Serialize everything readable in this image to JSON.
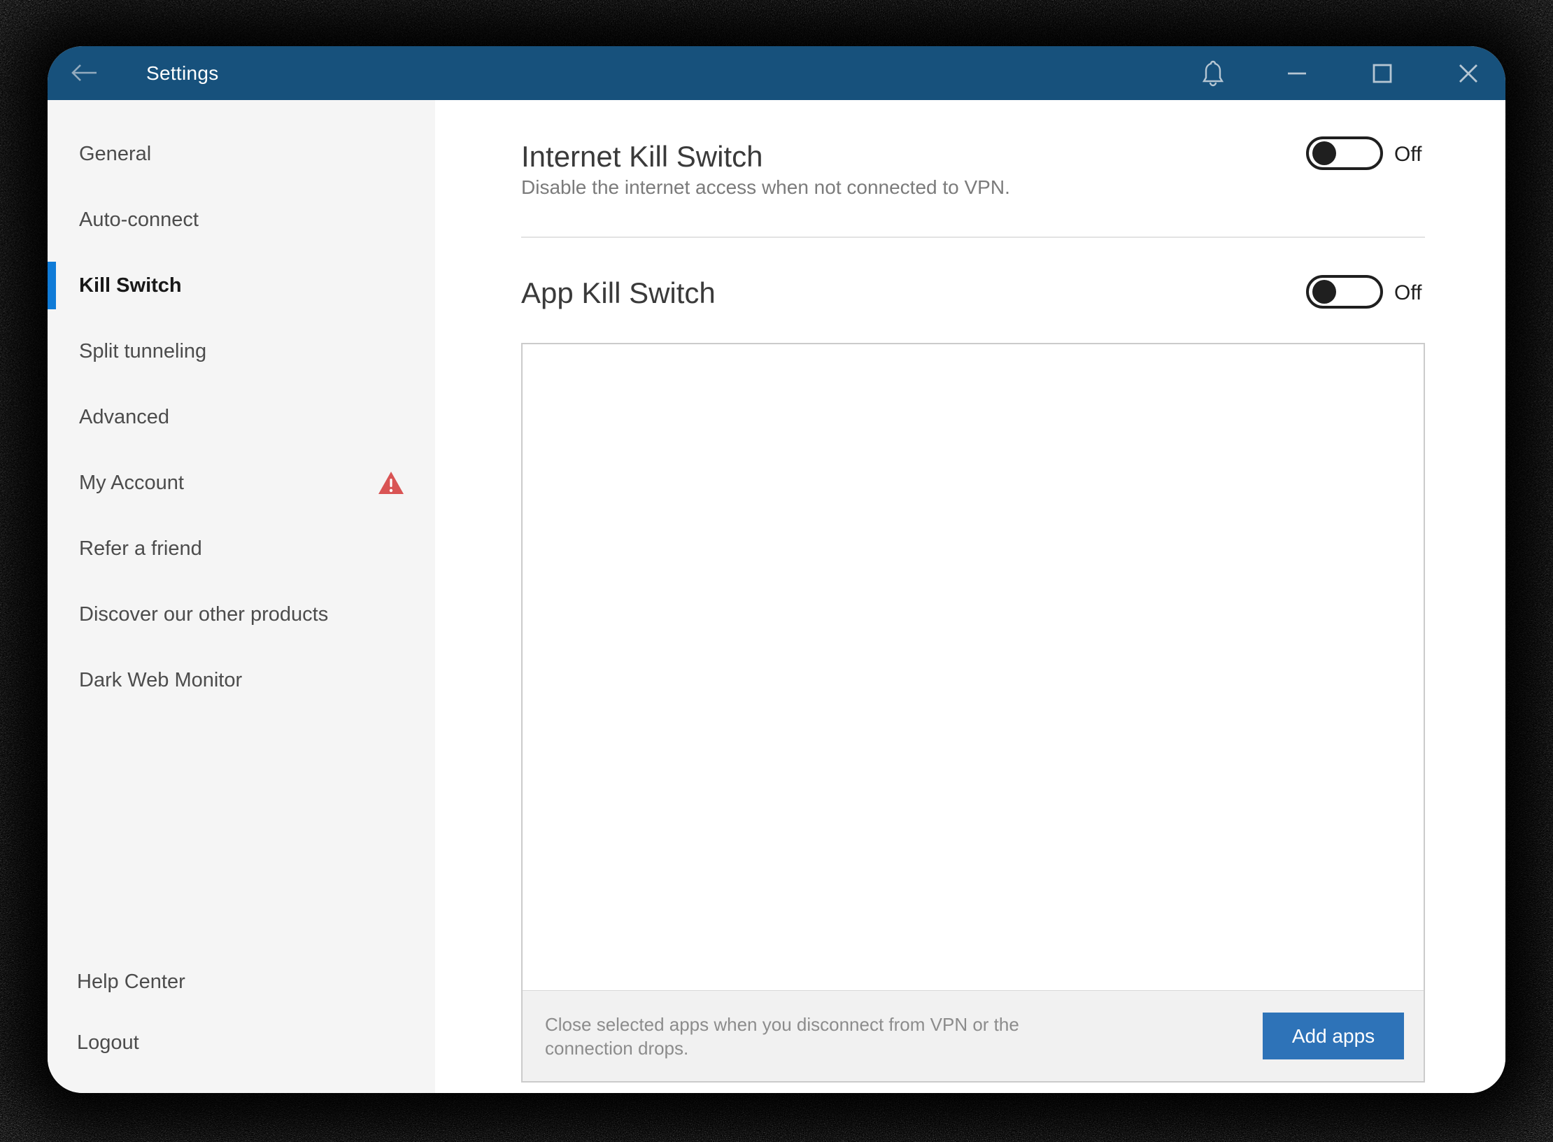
{
  "window": {
    "title": "Settings",
    "controls": {
      "back": "back-arrow",
      "notifications": "bell",
      "minimize": "minimize",
      "maximize": "maximize",
      "close": "close"
    }
  },
  "sidebar": {
    "items": [
      {
        "label": "General",
        "selected": false,
        "warning": false
      },
      {
        "label": "Auto-connect",
        "selected": false,
        "warning": false
      },
      {
        "label": "Kill Switch",
        "selected": true,
        "warning": false
      },
      {
        "label": "Split tunneling",
        "selected": false,
        "warning": false
      },
      {
        "label": "Advanced",
        "selected": false,
        "warning": false
      },
      {
        "label": "My Account",
        "selected": false,
        "warning": true
      },
      {
        "label": "Refer a friend",
        "selected": false,
        "warning": false
      },
      {
        "label": "Discover our other products",
        "selected": false,
        "warning": false
      },
      {
        "label": "Dark Web Monitor",
        "selected": false,
        "warning": false
      }
    ],
    "bottom_items": [
      {
        "label": "Help Center"
      },
      {
        "label": "Logout"
      }
    ]
  },
  "main": {
    "internet_kill_switch": {
      "title": "Internet Kill Switch",
      "description": "Disable the internet access when not connected to VPN.",
      "state": "Off"
    },
    "app_kill_switch": {
      "title": "App Kill Switch",
      "state": "Off",
      "footer_text": "Close selected apps when you disconnect from VPN or the connection drops.",
      "add_button_label": "Add apps"
    }
  },
  "colors": {
    "titlebar": "#17517c",
    "accent": "#0f7bd7",
    "warning_red": "#d95454",
    "add_button_blue": "#2e73b8",
    "sidebar_bg": "#f5f5f5",
    "footer_bg": "#f1f1f1"
  }
}
